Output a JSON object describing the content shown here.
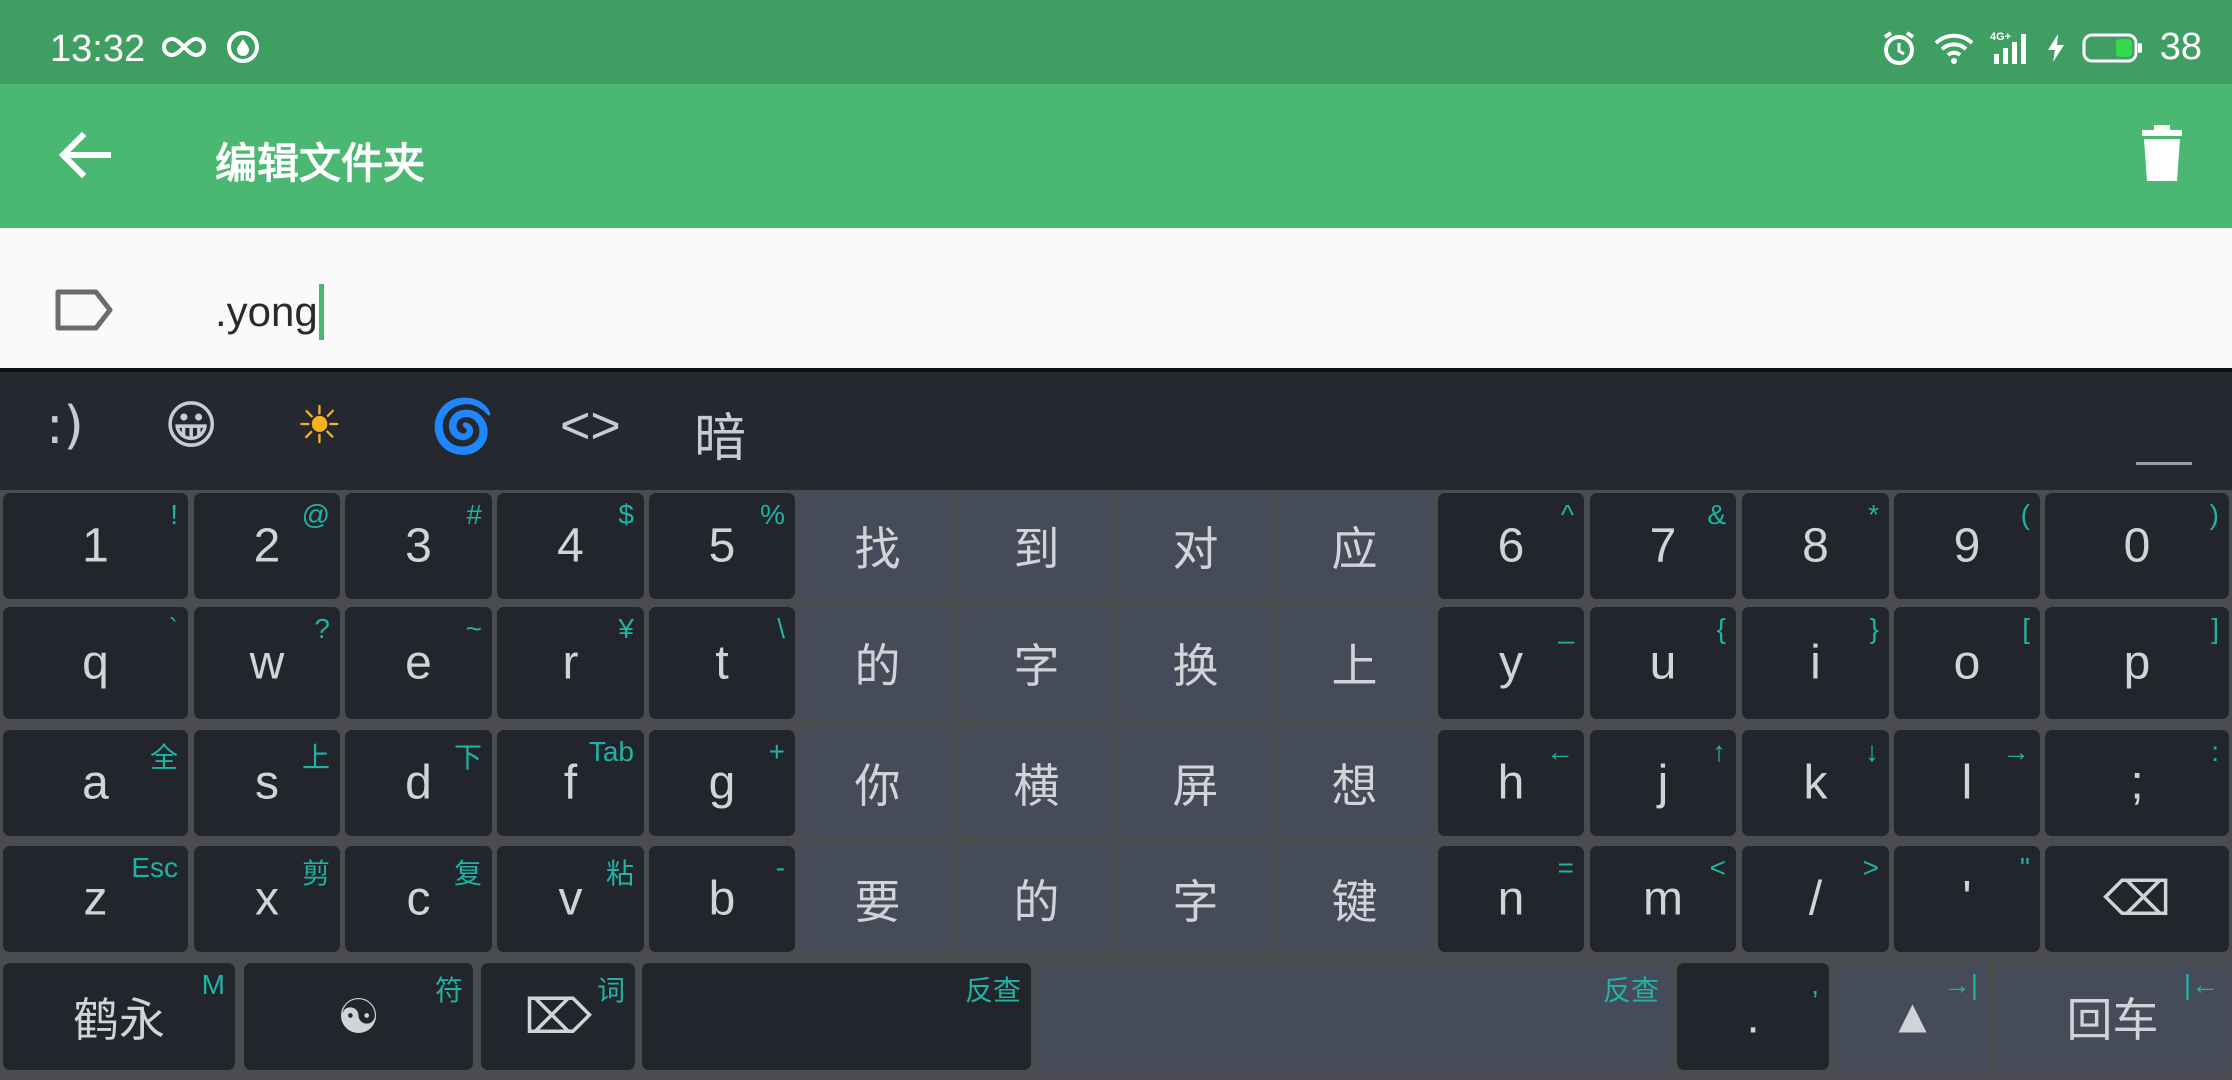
{
  "status": {
    "time": "13:32",
    "network": "4G+",
    "battery": "38"
  },
  "appbar": {
    "title": "编辑文件夹"
  },
  "field": {
    "value": ".yong"
  },
  "candidates": [
    ":)",
    "😀",
    "☀",
    "🌀",
    "<>",
    "暗"
  ],
  "keys": {
    "row1": [
      {
        "main": "1",
        "hint": "!"
      },
      {
        "main": "2",
        "hint": "@"
      },
      {
        "main": "3",
        "hint": "#"
      },
      {
        "main": "4",
        "hint": "$"
      },
      {
        "main": "5",
        "hint": "%"
      },
      {
        "main": "找",
        "hint": ""
      },
      {
        "main": "到",
        "hint": ""
      },
      {
        "main": "对",
        "hint": ""
      },
      {
        "main": "应",
        "hint": ""
      },
      {
        "main": "6",
        "hint": "^"
      },
      {
        "main": "7",
        "hint": "&"
      },
      {
        "main": "8",
        "hint": "*"
      },
      {
        "main": "9",
        "hint": "("
      },
      {
        "main": "0",
        "hint": ")"
      }
    ],
    "row2": [
      {
        "main": "q",
        "hint": "`"
      },
      {
        "main": "w",
        "hint": "?"
      },
      {
        "main": "e",
        "hint": "~"
      },
      {
        "main": "r",
        "hint": "¥"
      },
      {
        "main": "t",
        "hint": "\\"
      },
      {
        "main": "的",
        "hint": ""
      },
      {
        "main": "字",
        "hint": ""
      },
      {
        "main": "换",
        "hint": ""
      },
      {
        "main": "上",
        "hint": ""
      },
      {
        "main": "y",
        "hint": "_"
      },
      {
        "main": "u",
        "hint": "{"
      },
      {
        "main": "i",
        "hint": "}"
      },
      {
        "main": "o",
        "hint": "["
      },
      {
        "main": "p",
        "hint": "]"
      }
    ],
    "row3": [
      {
        "main": "a",
        "hint": "全"
      },
      {
        "main": "s",
        "hint": "上"
      },
      {
        "main": "d",
        "hint": "下"
      },
      {
        "main": "f",
        "hint": "Tab"
      },
      {
        "main": "g",
        "hint": "+"
      },
      {
        "main": "你",
        "hint": ""
      },
      {
        "main": "横",
        "hint": ""
      },
      {
        "main": "屏",
        "hint": ""
      },
      {
        "main": "想",
        "hint": ""
      },
      {
        "main": "h",
        "hint": "←"
      },
      {
        "main": "j",
        "hint": "↑"
      },
      {
        "main": "k",
        "hint": "↓"
      },
      {
        "main": "l",
        "hint": "→"
      },
      {
        "main": ";",
        "hint": ":"
      }
    ],
    "row4": [
      {
        "main": "z",
        "hint": "Esc"
      },
      {
        "main": "x",
        "hint": "剪"
      },
      {
        "main": "c",
        "hint": "复"
      },
      {
        "main": "v",
        "hint": "粘"
      },
      {
        "main": "b",
        "hint": "-"
      },
      {
        "main": "要",
        "hint": ""
      },
      {
        "main": "的",
        "hint": ""
      },
      {
        "main": "字",
        "hint": ""
      },
      {
        "main": "键",
        "hint": ""
      },
      {
        "main": "n",
        "hint": "="
      },
      {
        "main": "m",
        "hint": "<"
      },
      {
        "main": "/",
        "hint": ">"
      },
      {
        "main": "'",
        "hint": "\""
      },
      {
        "main": "⌫",
        "hint": ""
      }
    ],
    "row5": [
      {
        "main": "鹤永",
        "hint": "M"
      },
      {
        "main": "☯",
        "hint": "符"
      },
      {
        "main": "⌦",
        "hint": "词"
      },
      {
        "main": "",
        "hint": "反查"
      },
      {
        "main": "",
        "hint": "反查"
      },
      {
        "main": ".",
        "hint": ","
      },
      {
        "main": "▲",
        "hint": "→|"
      },
      {
        "main": "回车",
        "hint": "|←"
      }
    ]
  }
}
